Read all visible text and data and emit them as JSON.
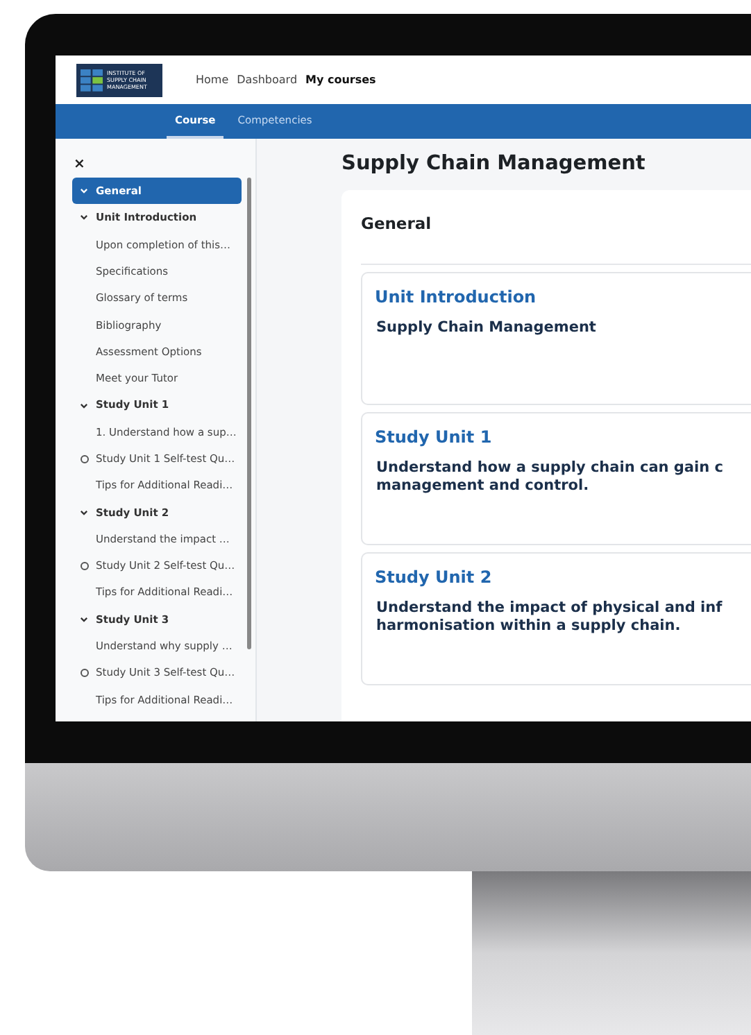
{
  "logo": {
    "lines": [
      "INSTITUTE OF",
      "SUPPLY CHAIN",
      "MANAGEMENT"
    ]
  },
  "nav": [
    {
      "label": "Home",
      "selected": false
    },
    {
      "label": "Dashboard",
      "selected": false
    },
    {
      "label": "My courses",
      "selected": true
    }
  ],
  "tabs": [
    {
      "label": "Course",
      "selected": true
    },
    {
      "label": "Competencies",
      "selected": false
    }
  ],
  "sidebar": {
    "close": "×",
    "sections": [
      {
        "label": "General",
        "selected": true,
        "expanded": true
      },
      {
        "label": "Unit Introduction",
        "selected": false,
        "expanded": true,
        "children": [
          {
            "label": "Upon completion of this…",
            "kind": "page"
          },
          {
            "label": "Specifications",
            "kind": "page"
          },
          {
            "label": "Glossary of terms",
            "kind": "page"
          },
          {
            "label": "Bibliography",
            "kind": "page"
          },
          {
            "label": "Assessment Options",
            "kind": "page"
          },
          {
            "label": "Meet your Tutor",
            "kind": "page"
          }
        ]
      },
      {
        "label": "Study Unit 1",
        "selected": false,
        "expanded": true,
        "children": [
          {
            "label": "1. Understand how a sup…",
            "kind": "page"
          },
          {
            "label": "Study Unit 1 Self-test Qu…",
            "kind": "quiz"
          },
          {
            "label": "Tips for Additional Readi…",
            "kind": "page"
          }
        ]
      },
      {
        "label": "Study Unit 2",
        "selected": false,
        "expanded": true,
        "children": [
          {
            "label": "Understand the impact …",
            "kind": "page"
          },
          {
            "label": "Study Unit 2 Self-test Qu…",
            "kind": "quiz"
          },
          {
            "label": "Tips for Additional Readi…",
            "kind": "page"
          }
        ]
      },
      {
        "label": "Study Unit 3",
        "selected": false,
        "expanded": true,
        "children": [
          {
            "label": "Understand why supply …",
            "kind": "page"
          },
          {
            "label": "Study Unit 3 Self-test Qu…",
            "kind": "quiz"
          },
          {
            "label": "Tips for Additional Readi…",
            "kind": "page"
          }
        ]
      }
    ]
  },
  "course": {
    "title": "Supply Chain Management",
    "section_title": "General",
    "cards": [
      {
        "heading": "Unit Introduction",
        "lines": [
          "Supply Chain Management"
        ]
      },
      {
        "heading": "Study Unit 1",
        "lines": [
          "Understand how a supply chain can gain c",
          "management and control."
        ]
      },
      {
        "heading": "Study Unit 2",
        "lines": [
          "Understand the impact of physical and inf",
          "harmonisation within a supply chain."
        ]
      }
    ]
  }
}
